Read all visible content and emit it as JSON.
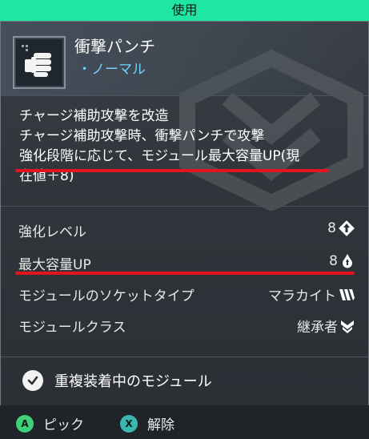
{
  "window": {
    "title": "使用"
  },
  "item": {
    "name": "衝撃パンチ",
    "rarity": "・ノーマル",
    "icon": "fist-icon"
  },
  "description": [
    "チャージ補助攻撃を改造",
    "チャージ補助攻撃時、衝撃パンチで攻撃",
    "強化段階に応じて、モジュール最大容量UP(現",
    "在値＋8)"
  ],
  "stats": [
    {
      "label": "強化レベル",
      "value": "8",
      "icon": "upgrade-level-icon"
    },
    {
      "label": "最大容量UP",
      "value": "8",
      "icon": "capacity-icon"
    },
    {
      "label": "モジュールのソケットタイプ",
      "value": "マラカイト",
      "icon": "malachite-socket-icon"
    },
    {
      "label": "モジュールクラス",
      "value": "継承者",
      "icon": "inheritor-class-icon"
    }
  ],
  "duplicate_label": "重複装着中のモジュール",
  "footer": {
    "a_button": "A",
    "a_label": "ピック",
    "x_button": "X",
    "x_label": "解除"
  },
  "colors": {
    "top_bar": "#1fe6a0",
    "rarity": "#74d2ff",
    "highlight_underline": "#e3141b",
    "a_button": "#3fd07a",
    "x_button": "#3ab7b0"
  }
}
